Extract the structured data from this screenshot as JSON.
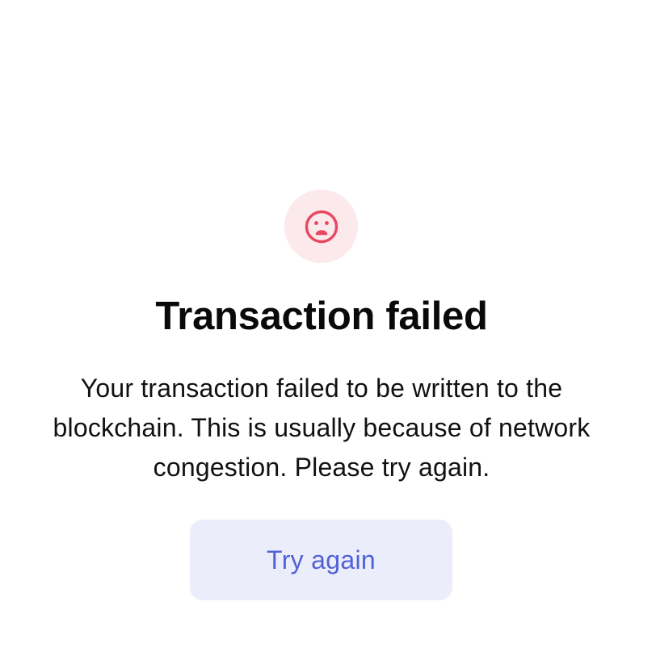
{
  "dialog": {
    "icon": "sad-face-icon",
    "title": "Transaction failed",
    "message": "Your transaction failed to be written to the blockchain. This is usually because of network congestion. Please try again.",
    "button_label": "Try again"
  },
  "colors": {
    "icon_background": "#fbe9ec",
    "icon_stroke": "#e8475f",
    "title_text": "#0a0a0a",
    "body_text": "#111111",
    "button_background": "#ecedfb",
    "button_text": "#4f62d6"
  }
}
